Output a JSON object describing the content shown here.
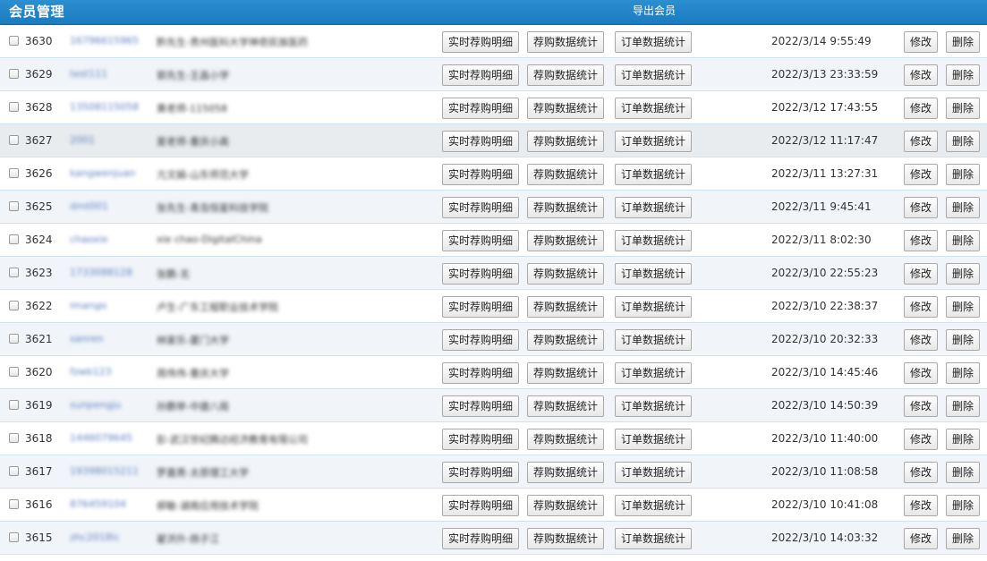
{
  "header": {
    "title": "会员管理",
    "export_label": "导出会员"
  },
  "actions": {
    "realtime_label": "实时荐购明细",
    "stats_label": "荐购数据统计",
    "orders_label": "订单数据统计",
    "edit_label": "修改",
    "delete_label": "删除"
  },
  "rows": [
    {
      "id": "3630",
      "username": "16796615965",
      "name": "黔先生-贵州医科大学神奇民族医药",
      "date": "2022/3/14 9:55:49"
    },
    {
      "id": "3629",
      "username": "test111",
      "name": "郭先生-王昌小学",
      "date": "2022/3/13 23:33:59"
    },
    {
      "id": "3628",
      "username": "13508115058",
      "name": "黄老师-115058",
      "date": "2022/3/12 17:43:55"
    },
    {
      "id": "3627",
      "username": "2001",
      "name": "夏老师-重庆小高",
      "date": "2022/3/12 11:17:47"
    },
    {
      "id": "3626",
      "username": "kangwenjuan",
      "name": "亢文娟-山东师范大学",
      "date": "2022/3/11 13:27:31"
    },
    {
      "id": "3625",
      "username": "dmt001",
      "name": "张先生-青岛恒星科技学院",
      "date": "2022/3/11 9:45:41"
    },
    {
      "id": "3624",
      "username": "chaoxie",
      "name": "xie chao-DigitalChina",
      "date": "2022/3/11 8:02:30"
    },
    {
      "id": "3623",
      "username": "1733088128",
      "name": "张鹏-无",
      "date": "2022/3/10 22:55:23"
    },
    {
      "id": "3622",
      "username": "imango",
      "name": "卢生-广东工程职业技术学院",
      "date": "2022/3/10 22:38:37"
    },
    {
      "id": "3621",
      "username": "sanren",
      "name": "林家乐-厦门大学",
      "date": "2022/3/10 20:32:33"
    },
    {
      "id": "3620",
      "username": "fzwb123",
      "name": "周伟伟-重庆大学",
      "date": "2022/3/10 14:45:46"
    },
    {
      "id": "3619",
      "username": "sunpengju",
      "name": "孙鹏举-中建八局",
      "date": "2022/3/10 14:50:39"
    },
    {
      "id": "3618",
      "username": "1446079645",
      "name": "彭-武汉世纪腾达经济教育有限公司",
      "date": "2022/3/10 11:40:00"
    },
    {
      "id": "3617",
      "username": "19398015211",
      "name": "罗嘉男-太原理工大学",
      "date": "2022/3/10 11:08:58"
    },
    {
      "id": "3616",
      "username": "876459104",
      "name": "郝敏-湖南应用技术学院",
      "date": "2022/3/10 10:41:08"
    },
    {
      "id": "3615",
      "username": "zhc2018lc",
      "name": "翟洪升-扬子江",
      "date": "2022/3/10 14:03:32"
    }
  ],
  "colors": {
    "header_bg": "#1a7bc0",
    "link": "#5c7fbf",
    "row_alt": "#f1f5f9",
    "row_border": "#cfe2ef"
  }
}
